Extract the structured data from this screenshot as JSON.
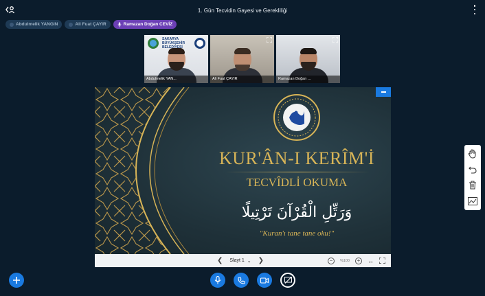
{
  "meeting": {
    "title": "1. Gün Tecvidin Gayesi ve Gerekliliği"
  },
  "talkers": [
    {
      "name": "Abdulmelik YANGIN",
      "active": false
    },
    {
      "name": "Ali Fuat ÇAYIR",
      "active": false
    },
    {
      "name": "Ramazan Doğan CEVİZ",
      "active": true
    }
  ],
  "videos": [
    {
      "name": "Abdulmelik YAN...",
      "background_text": [
        "SAKARYA",
        "BÜYÜKŞEHİR",
        "BELEDİYESİ"
      ]
    },
    {
      "name": "Ali Fuat ÇAYIR"
    },
    {
      "name": "Ramazan Doğan ...",
      "speaking": true
    }
  ],
  "slide": {
    "title": "KUR'ÂN-I KERÎM'İ",
    "subtitle": "TECVÎDLİ OKUMA",
    "arabic": "وَرَتِّلِ الْقُرْآنَ تَرْتِيلًا",
    "quote": "\"Kuran'ı tane tane oku!\""
  },
  "presentation_controls": {
    "slide_label": "Slayt 1",
    "zoom": "%100"
  },
  "colors": {
    "accent": "#1a7ae0",
    "active_talker": "#6b3fb5",
    "background": "#0b1c2c",
    "slide_gold": "#d7b457"
  },
  "icons": {
    "top_left": "user-list-icon",
    "top_right": "more-options-icon",
    "whiteboard": [
      "hand-icon",
      "undo-icon",
      "trash-icon",
      "multi-user-icon"
    ],
    "bottom": [
      "plus-icon",
      "microphone-icon",
      "phone-icon",
      "camera-icon",
      "screen-share-off-icon"
    ]
  }
}
